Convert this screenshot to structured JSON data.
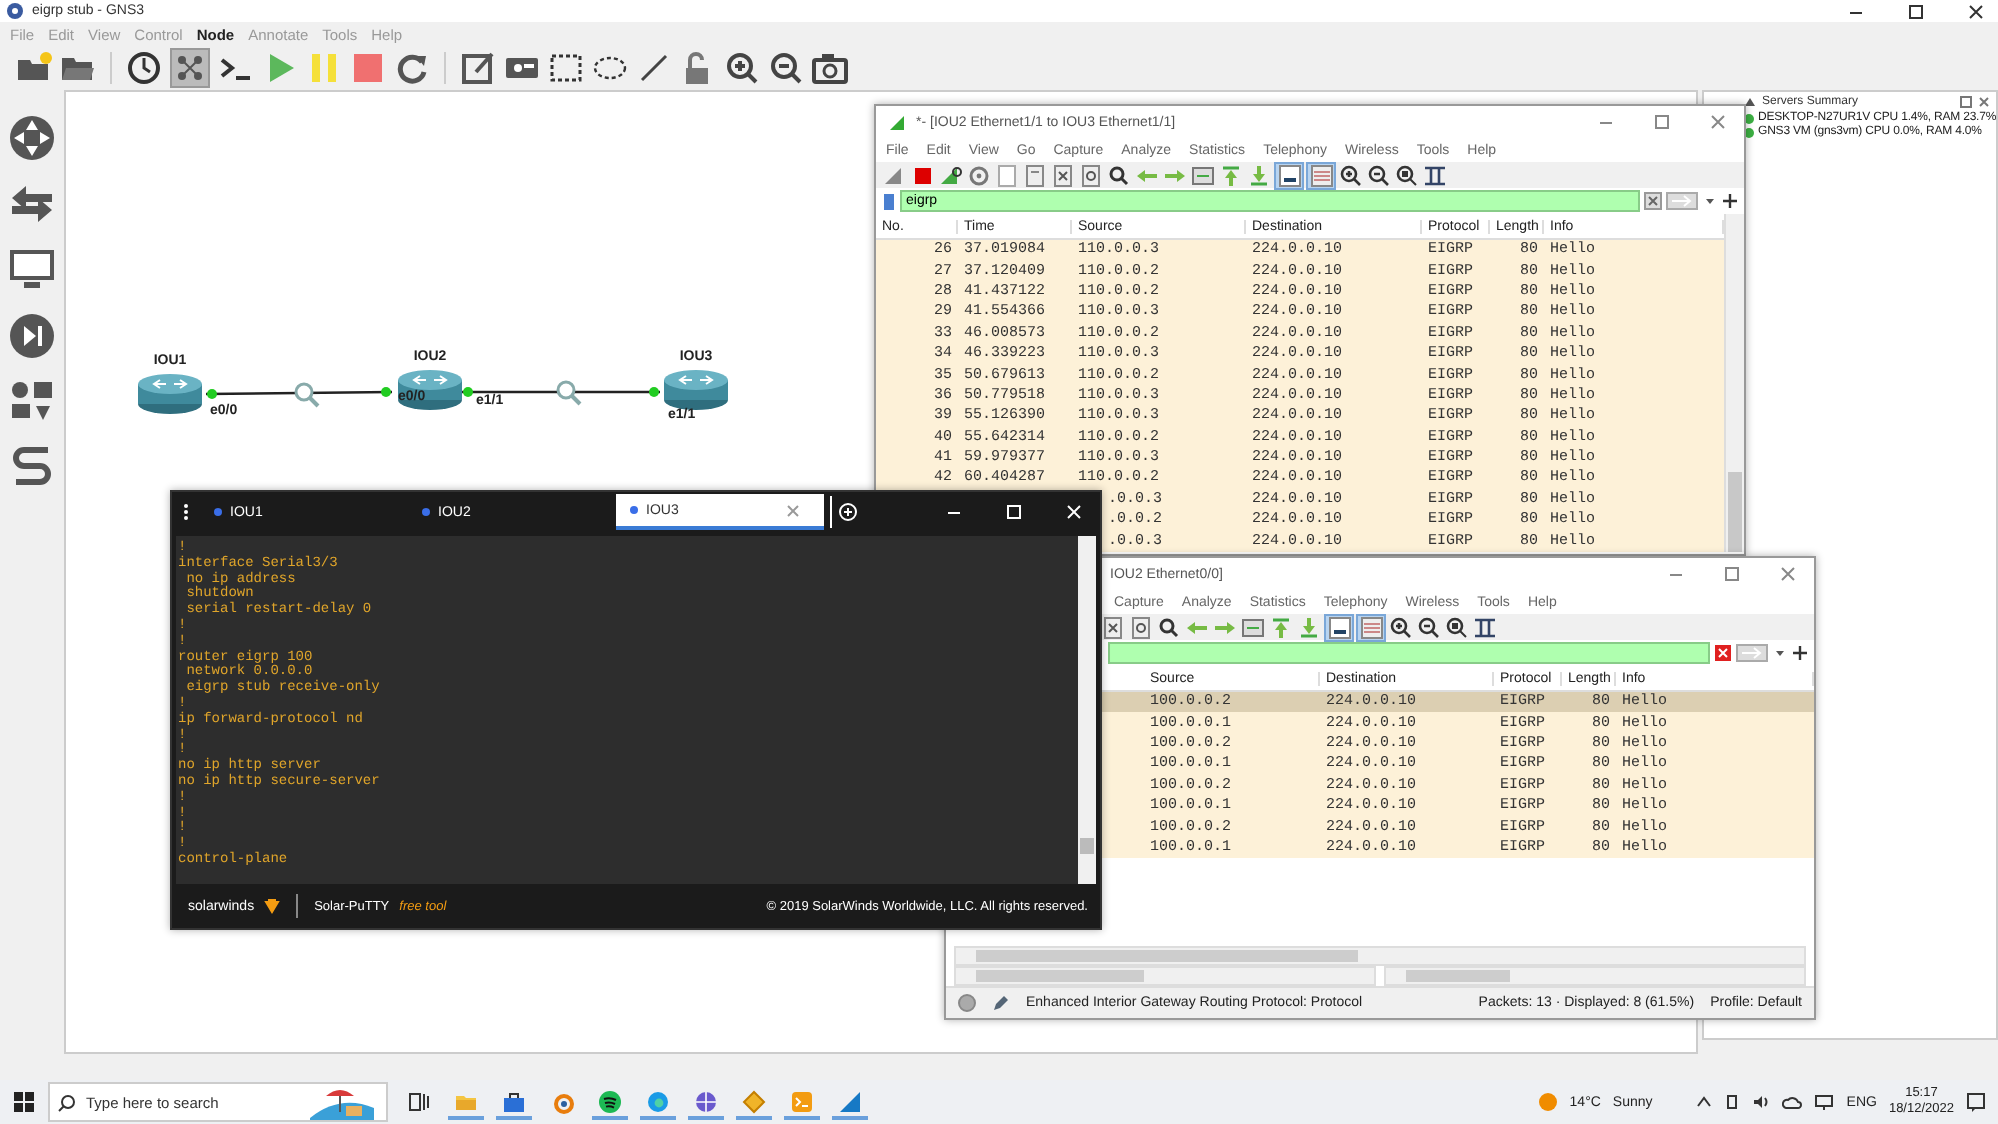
{
  "window": {
    "title": "eigrp stub - GNS3"
  },
  "menu": [
    {
      "label": "File",
      "selected": false
    },
    {
      "label": "Edit",
      "selected": false
    },
    {
      "label": "View",
      "selected": false
    },
    {
      "label": "Control",
      "selected": false
    },
    {
      "label": "Node",
      "selected": true
    },
    {
      "label": "Annotate",
      "selected": false
    },
    {
      "label": "Tools",
      "selected": false
    },
    {
      "label": "Help",
      "selected": false
    }
  ],
  "toolbar": {
    "interface_labels_on": true
  },
  "nodes": [
    {
      "name": "IOU1"
    },
    {
      "name": "IOU2"
    },
    {
      "name": "IOU3"
    }
  ],
  "links": [
    {
      "label_a": "e0/0",
      "label_b": "e0/0",
      "up": true,
      "capturing": true
    },
    {
      "label_a": "e1/1",
      "label_b": "e1/1",
      "up": true,
      "capturing": true
    }
  ],
  "servers_summary": {
    "title": "Servers Summary",
    "servers": [
      {
        "name": "DESKTOP-N27UR1V CPU 1.4%, RAM 23.7%",
        "color": "#3cb043"
      },
      {
        "name": "GNS3 VM (gns3vm) CPU 0.0%, RAM 4.0%",
        "color": "#3cb043"
      }
    ]
  },
  "capture_window_1": {
    "title": "*- [IOU2 Ethernet1/1 to IOU3 Ethernet1/1]",
    "menu": [
      "File",
      "Edit",
      "View",
      "Go",
      "Capture",
      "Analyze",
      "Statistics",
      "Telephony",
      "Wireless",
      "Tools",
      "Help"
    ],
    "autoscroll_on": true,
    "colorize_on": true,
    "filter": "eigrp",
    "columns": [
      "No.",
      "Time",
      "Source",
      "Destination",
      "Protocol",
      "Length",
      "Info"
    ],
    "rows": [
      {
        "no": "26",
        "time": "37.019084",
        "source": "110.0.0.3",
        "destination": "224.0.0.10",
        "protocol": "EIGRP",
        "length": "80",
        "info": "Hello"
      },
      {
        "no": "27",
        "time": "37.120409",
        "source": "110.0.0.2",
        "destination": "224.0.0.10",
        "protocol": "EIGRP",
        "length": "80",
        "info": "Hello"
      },
      {
        "no": "28",
        "time": "41.437122",
        "source": "110.0.0.2",
        "destination": "224.0.0.10",
        "protocol": "EIGRP",
        "length": "80",
        "info": "Hello"
      },
      {
        "no": "29",
        "time": "41.554366",
        "source": "110.0.0.3",
        "destination": "224.0.0.10",
        "protocol": "EIGRP",
        "length": "80",
        "info": "Hello"
      },
      {
        "no": "33",
        "time": "46.008573",
        "source": "110.0.0.2",
        "destination": "224.0.0.10",
        "protocol": "EIGRP",
        "length": "80",
        "info": "Hello"
      },
      {
        "no": "34",
        "time": "46.339223",
        "source": "110.0.0.3",
        "destination": "224.0.0.10",
        "protocol": "EIGRP",
        "length": "80",
        "info": "Hello"
      },
      {
        "no": "35",
        "time": "50.679613",
        "source": "110.0.0.2",
        "destination": "224.0.0.10",
        "protocol": "EIGRP",
        "length": "80",
        "info": "Hello"
      },
      {
        "no": "36",
        "time": "50.779518",
        "source": "110.0.0.3",
        "destination": "224.0.0.10",
        "protocol": "EIGRP",
        "length": "80",
        "info": "Hello"
      },
      {
        "no": "39",
        "time": "55.126390",
        "source": "110.0.0.3",
        "destination": "224.0.0.10",
        "protocol": "EIGRP",
        "length": "80",
        "info": "Hello"
      },
      {
        "no": "40",
        "time": "55.642314",
        "source": "110.0.0.2",
        "destination": "224.0.0.10",
        "protocol": "EIGRP",
        "length": "80",
        "info": "Hello"
      },
      {
        "no": "41",
        "time": "59.979377",
        "source": "110.0.0.3",
        "destination": "224.0.0.10",
        "protocol": "EIGRP",
        "length": "80",
        "info": "Hello"
      },
      {
        "no": "42",
        "time": "60.404287",
        "source": "110.0.0.2",
        "destination": "224.0.0.10",
        "protocol": "EIGRP",
        "length": "80",
        "info": "Hello"
      },
      {
        "source": ".0.0.3",
        "destination": "224.0.0.10",
        "protocol": "EIGRP",
        "length": "80",
        "info": "Hello"
      },
      {
        "source": ".0.0.2",
        "destination": "224.0.0.10",
        "protocol": "EIGRP",
        "length": "80",
        "info": "Hello"
      },
      {
        "source": ".0.0.3",
        "destination": "224.0.0.10",
        "protocol": "EIGRP",
        "length": "80",
        "info": "Hello"
      }
    ]
  },
  "capture_window_2": {
    "title": "IOU2 Ethernet0/0]",
    "menu": [
      "Capture",
      "Analyze",
      "Statistics",
      "Telephony",
      "Wireless",
      "Tools",
      "Help"
    ],
    "autoscroll_on": true,
    "colorize_on": true,
    "columns": [
      "Source",
      "Destination",
      "Protocol",
      "Length",
      "Info"
    ],
    "rows": [
      {
        "source": "100.0.0.2",
        "destination": "224.0.0.10",
        "protocol": "EIGRP",
        "length": "80",
        "info": "Hello",
        "selected": true
      },
      {
        "source": "100.0.0.1",
        "destination": "224.0.0.10",
        "protocol": "EIGRP",
        "length": "80",
        "info": "Hello",
        "selected": false
      },
      {
        "source": "100.0.0.2",
        "destination": "224.0.0.10",
        "protocol": "EIGRP",
        "length": "80",
        "info": "Hello",
        "selected": false
      },
      {
        "source": "100.0.0.1",
        "destination": "224.0.0.10",
        "protocol": "EIGRP",
        "length": "80",
        "info": "Hello",
        "selected": false
      },
      {
        "source": "100.0.0.2",
        "destination": "224.0.0.10",
        "protocol": "EIGRP",
        "length": "80",
        "info": "Hello",
        "selected": false
      },
      {
        "source": "100.0.0.1",
        "destination": "224.0.0.10",
        "protocol": "EIGRP",
        "length": "80",
        "info": "Hello",
        "selected": false
      },
      {
        "source": "100.0.0.2",
        "destination": "224.0.0.10",
        "protocol": "EIGRP",
        "length": "80",
        "info": "Hello",
        "selected": false
      },
      {
        "source": "100.0.0.1",
        "destination": "224.0.0.10",
        "protocol": "EIGRP",
        "length": "80",
        "info": "Hello",
        "selected": false
      }
    ],
    "status": {
      "field": "Enhanced Interior Gateway Routing Protocol: Protocol",
      "packets": "Packets: 13 · Displayed: 8 (61.5%)",
      "profile": "Profile: Default"
    }
  },
  "terminal": {
    "tabs": [
      {
        "label": "IOU1",
        "selected": false
      },
      {
        "label": "IOU2",
        "selected": false
      },
      {
        "label": "IOU3",
        "selected": true
      }
    ],
    "lines": [
      "!",
      "interface Serial3/3",
      " no ip address",
      " shutdown",
      " serial restart-delay 0",
      "!",
      "!",
      "router eigrp 100",
      " network 0.0.0.0",
      " eigrp stub receive-only",
      "!",
      "ip forward-protocol nd",
      "!",
      "!",
      "no ip http server",
      "no ip http secure-server",
      "!",
      "!",
      "!",
      "!",
      "control-plane"
    ],
    "brand": "solarwinds",
    "product": "Solar-PuTTY",
    "tagline": "free tool",
    "copyright": "© 2019 SolarWinds Worldwide, LLC. All rights reserved."
  },
  "taskbar": {
    "search_placeholder": "Type here to search",
    "apps": [
      {
        "kind": "task-view",
        "running": false
      },
      {
        "kind": "folder",
        "running": true
      },
      {
        "kind": "bag",
        "running": true
      },
      {
        "kind": "ring",
        "running": false
      },
      {
        "kind": "waves",
        "running": true
      },
      {
        "kind": "swirl",
        "running": true
      },
      {
        "kind": "globe",
        "running": true
      },
      {
        "kind": "diamond",
        "running": true
      },
      {
        "kind": "terminal",
        "running": true
      },
      {
        "kind": "fin",
        "running": true
      }
    ],
    "temperature": "14°C",
    "weather": "Sunny",
    "language": "ENG",
    "time": "15:17",
    "date": "18/12/2022"
  }
}
